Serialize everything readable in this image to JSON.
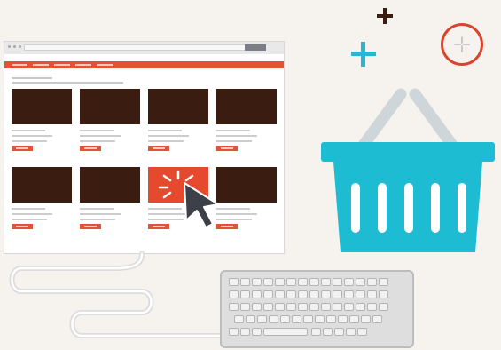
{
  "colors": {
    "background": "#f6f3ef",
    "accent": "#e25236",
    "product_thumb": "#3a1d10",
    "basket": "#1ebcd3",
    "basket_handle": "#cfd6da",
    "cursor": "#3d4048",
    "plus_teal": "#29b6cf",
    "plus_brown": "#3a1d10",
    "circle_red": "#d9442e"
  },
  "icons": {
    "cursor": "mouse-pointer-icon",
    "basket": "shopping-basket-icon",
    "keyboard": "keyboard-icon",
    "plus_small": "plus-icon",
    "plus_teal": "plus-icon",
    "circle_plus": "add-circle-icon"
  },
  "browser": {
    "product_rows": 2,
    "product_columns": 4,
    "selected_product": "row-2-column-3"
  }
}
